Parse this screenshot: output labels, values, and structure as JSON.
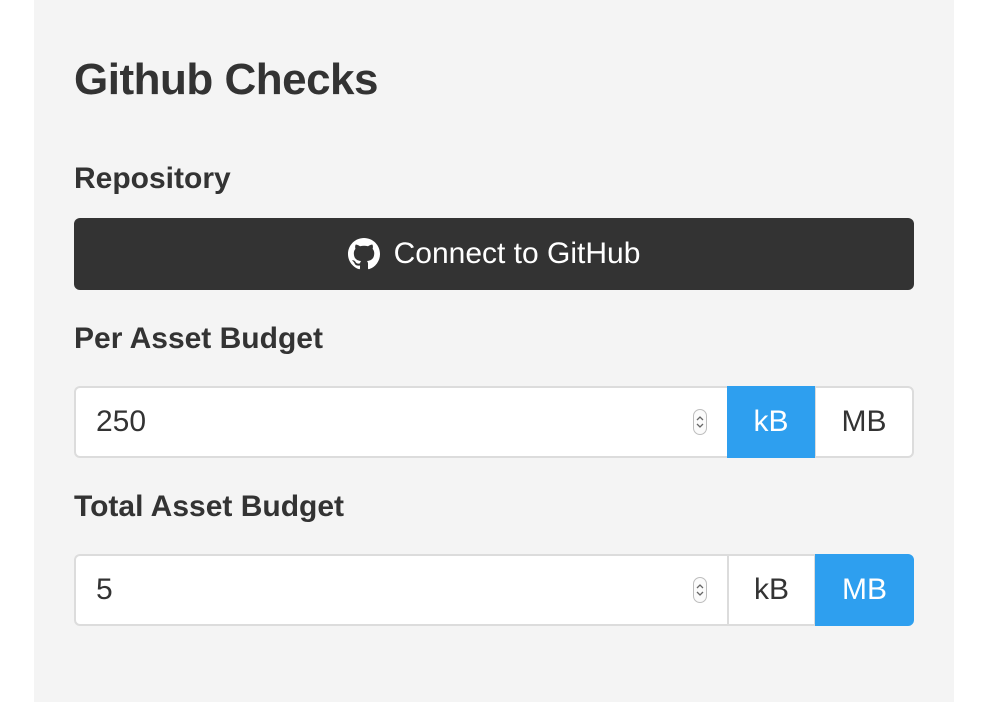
{
  "page": {
    "title": "Github Checks"
  },
  "repository": {
    "label": "Repository",
    "connect_button_label": "Connect to GitHub",
    "icon": "github-icon"
  },
  "per_asset_budget": {
    "label": "Per Asset Budget",
    "value": "250",
    "units": [
      "kB",
      "MB"
    ],
    "selected_unit": "kB"
  },
  "total_asset_budget": {
    "label": "Total Asset Budget",
    "value": "5",
    "units": [
      "kB",
      "MB"
    ],
    "selected_unit": "MB"
  },
  "colors": {
    "accent": "#2e9fef",
    "button_dark": "#333333",
    "panel_bg": "#f4f4f4",
    "text": "#333333"
  }
}
